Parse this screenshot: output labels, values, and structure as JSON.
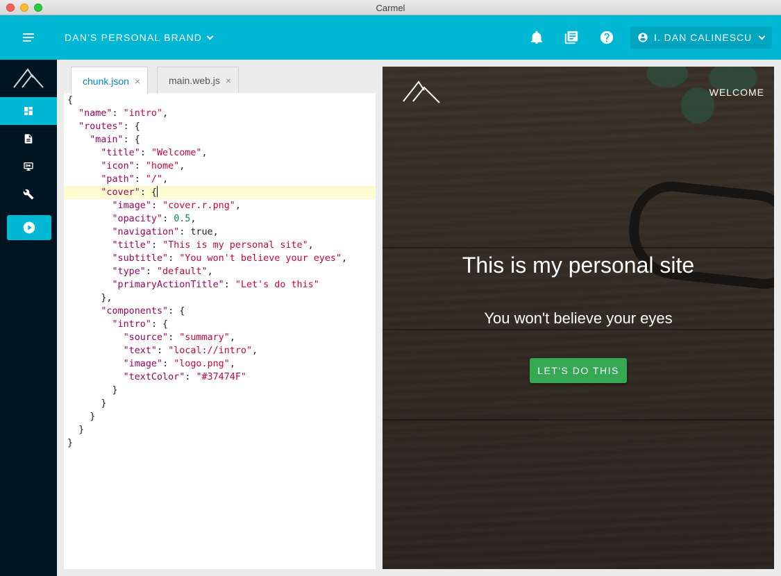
{
  "window": {
    "title": "Carmel"
  },
  "header": {
    "brand": "DAN'S PERSONAL BRAND",
    "user": "I. DAN CALINESCU",
    "icons": [
      "menu-icon",
      "bell-icon",
      "library-icon",
      "help-icon",
      "account-icon"
    ]
  },
  "rail": {
    "items": [
      "dashboard-icon",
      "document-icon",
      "screen-share-icon",
      "wrench-icon",
      "play-icon"
    ],
    "active": "dashboard-icon"
  },
  "editor": {
    "tabs": [
      {
        "label": "chunk.json",
        "active": true,
        "close": "×"
      },
      {
        "label": "main.web.js",
        "active": false,
        "close": "×"
      }
    ],
    "lines": [
      "{",
      "  \"name\": \"intro\",",
      "  \"routes\": {",
      "    \"main\": {",
      "      \"title\": \"Welcome\",",
      "      \"icon\": \"home\",",
      "      \"path\": \"/\",",
      "      \"cover\": {",
      "        \"image\": \"cover.r.png\",",
      "        \"opacity\": 0.5,",
      "        \"navigation\": true,",
      "        \"title\": \"This is my personal site\",",
      "        \"subtitle\": \"You won't believe your eyes\",",
      "        \"type\": \"default\",",
      "        \"primaryActionTitle\": \"Let's do this\"",
      "      },",
      "      \"components\": {",
      "        \"intro\": {",
      "          \"source\": \"summary\",",
      "          \"text\": \"local://intro\",",
      "          \"image\": \"logo.png\",",
      "          \"textColor\": \"#37474F\"",
      "        }",
      "      }",
      "    }",
      "  }",
      "}"
    ],
    "highlighted_line": 7
  },
  "preview": {
    "nav": "WELCOME",
    "title": "This is my personal site",
    "subtitle": "You won't believe your eyes",
    "action": "LET'S DO THIS"
  },
  "colors": {
    "header": "#00b8d4",
    "rail": "#001522",
    "button": "#34a853",
    "active_tab": "#0288d1"
  }
}
